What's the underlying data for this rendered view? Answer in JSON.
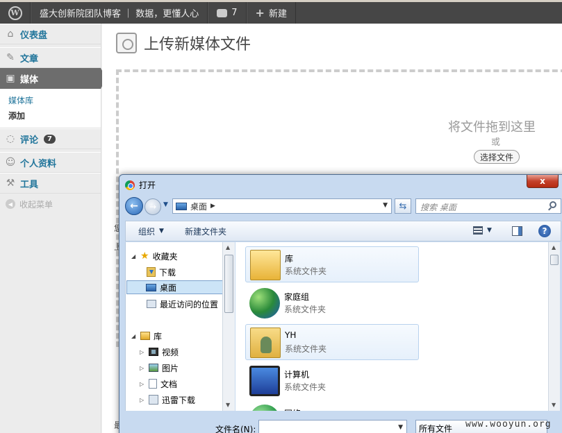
{
  "adminbar": {
    "site_name": "盛大创新院团队博客 ｜ 数据，更懂人心",
    "comments_count": "7",
    "new_label": "新建"
  },
  "sidebar": {
    "items": [
      {
        "label": "仪表盘"
      },
      {
        "label": "文章"
      },
      {
        "label": "媒体"
      },
      {
        "label": "评论",
        "badge": "7"
      },
      {
        "label": "个人资料"
      },
      {
        "label": "工具"
      }
    ],
    "media_submenu": [
      "媒体库",
      "添加"
    ],
    "collapse_label": "收起菜单"
  },
  "page": {
    "title": "上传新媒体文件",
    "drop_text": "将文件拖到这里",
    "or_text": "或",
    "select_button": "选择文件",
    "frag_1": "您",
    "frag_2": "上",
    "frag_3": "最"
  },
  "dialog": {
    "title": "打开",
    "close": "x",
    "address": "桌面",
    "search_placeholder": "搜索 桌面",
    "toolbar": {
      "organize": "组织",
      "new_folder": "新建文件夹"
    },
    "nav_tree": {
      "favorites": "收藏夹",
      "downloads": "下载",
      "desktop": "桌面",
      "recent": "最近访问的位置",
      "library": "库",
      "videos": "视频",
      "pictures": "图片",
      "documents": "文档",
      "thunder": "迅雷下载"
    },
    "files": [
      {
        "name": "库",
        "type": "系统文件夹",
        "icon": "library-icon"
      },
      {
        "name": "家庭组",
        "type": "系统文件夹",
        "icon": "homegroup-icon"
      },
      {
        "name": "YH",
        "type": "系统文件夹",
        "icon": "user-folder-icon"
      },
      {
        "name": "计算机",
        "type": "系统文件夹",
        "icon": "computer-icon"
      },
      {
        "name": "网络",
        "type": "",
        "icon": "network-icon"
      }
    ],
    "filename_label": "文件名(N):",
    "filetype": "所有文件"
  },
  "watermark": "www.wooyun.org"
}
